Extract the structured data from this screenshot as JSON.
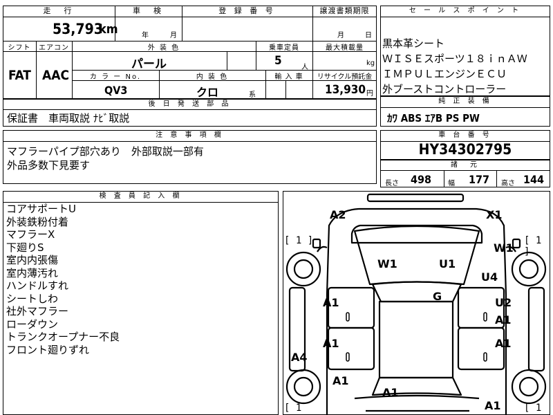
{
  "top_row": {
    "mileage_header": "走　行",
    "inspection_header": "車　検",
    "registration_header": "登 録 番 号",
    "transfer_deadline_header": "譲渡書類期限",
    "mileage_value": "53,793",
    "mileage_unit": "km",
    "inspection_year": "年",
    "inspection_month": "月",
    "transfer_month": "月",
    "transfer_day": "日"
  },
  "row2": {
    "shift_header": "シフト",
    "ac_header": "エアコン",
    "exterior_color_header": "外 装 色",
    "capacity_header": "乗車定員",
    "max_load_header": "最大積載量",
    "shift_value": "FAT",
    "ac_value": "AAC",
    "exterior_color_value": "パール",
    "capacity_value": "5",
    "capacity_unit": "人",
    "max_load_unit": "kg",
    "color_no_header": "カ ラ ー No.",
    "interior_color_header": "内 装 色",
    "import_header": "輸 入 車",
    "recycle_header": "リサイクル預託金",
    "color_no_value": "QV3",
    "interior_color_value": "クロ",
    "interior_suffix": "系",
    "recycle_value": "13,930",
    "recycle_unit": "円"
  },
  "delivery_parts": {
    "header": "後 日 発 送 部 品",
    "value": "保証書　車両取説 ﾅﾋﾞ取説"
  },
  "notes": {
    "header": "注 意 事 項 欄",
    "line1": "マフラーパイプ部穴あり　外部取説一部有",
    "line2": "外品多数下見要す"
  },
  "sales_points": {
    "header": "セ ー ル ス ポ イ ン ト",
    "items": [
      "黒本革シート",
      "ＷＩＳＥスポーツ１８ｉｎＡＷ",
      "ＩＭＰＵＬエンジンＥＣＵ",
      "外ブーストコントローラー"
    ]
  },
  "genuine_equipment": {
    "header": "純 正 装 備",
    "value": "ｶﾜ ABS ｴｱB PS PW"
  },
  "chassis": {
    "header": "車 台 番 号",
    "value": "HY34302795"
  },
  "dimensions": {
    "header": "諸　元",
    "length_label": "長さ",
    "length_value": "498",
    "width_label": "幅",
    "width_value": "177",
    "height_label": "高さ",
    "height_value": "144"
  },
  "inspector": {
    "header": "検 査 員 記 入 欄",
    "items": [
      "コアサポートU",
      "外装鉄粉付着",
      "マフラーX",
      "下廻りS",
      "室内内張傷",
      "室内薄汚れ",
      "ハンドルすれ",
      "シートしわ",
      "社外マフラー",
      "ローダウン",
      "トランクオープナー不良",
      "フロント廻りずれ"
    ]
  },
  "diagram": {
    "marks": {
      "a2_top": "A2",
      "x1_top": "X1",
      "w1_left": "W1",
      "u1": "U1",
      "w1_right": "W1",
      "u4": "U4",
      "g": "G",
      "a1_l1": "A1",
      "u2": "U2",
      "a1_r1": "A1",
      "a1_l2": "A1",
      "a1_r2": "A1",
      "a4": "A4",
      "a1_l3": "A1",
      "a1_bottom": "A1",
      "a1_br": "A1"
    },
    "bracket_tl": "[ 1 ]",
    "bracket_tr": "[ 1 ]",
    "bracket_bl": "[ 1",
    "bracket_br": "[ 1"
  }
}
